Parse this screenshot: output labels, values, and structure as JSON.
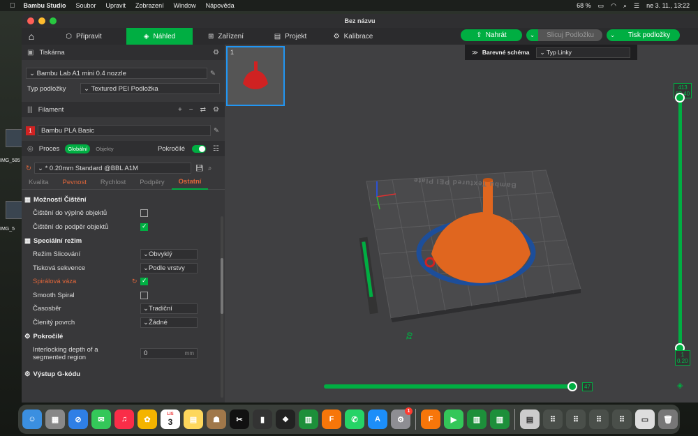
{
  "menubar": {
    "app_name": "Bambu Studio",
    "items": [
      "Soubor",
      "Upravit",
      "Zobrazení",
      "Window",
      "Nápověda"
    ],
    "battery": "68 %",
    "datetime": "ne 3. 11.,  13:22"
  },
  "desktop": {
    "label1": "IMG_585",
    "label2": "IMG_5"
  },
  "window": {
    "title": "Bez názvu"
  },
  "nav": {
    "tabs": [
      "Připravit",
      "Náhled",
      "Zařízení",
      "Projekt",
      "Kalibrace"
    ],
    "active_tab": "Náhled",
    "upload_label": "Nahrát",
    "slice_label": "Slicuj Podložku",
    "print_label": "Tisk podložky"
  },
  "printer": {
    "section_title": "Tiskárna",
    "printer_name": "Bambu Lab A1 mini 0.4 nozzle",
    "plate_type_label": "Typ podložky",
    "plate_type_value": "Textured PEI Podložka"
  },
  "filament": {
    "section_title": "Filament",
    "slot_number": "1",
    "filament_name": "Bambu PLA Basic"
  },
  "process": {
    "section_title": "Proces",
    "global_label": "Globální",
    "objects_label": "Objekty",
    "advanced_label": "Pokročilé",
    "profile": "* 0.20mm Standard @BBL A1M",
    "tabs": [
      "Kvalita",
      "Pevnost",
      "Rychlost",
      "Podpěry",
      "Ostatní"
    ],
    "active_tab": "Ostatní"
  },
  "options": {
    "cleaning_head": "Možnosti Čištění",
    "cleaning_infill": "Čištění do výplně objektů",
    "cleaning_support": "Čištění do podpěr objektů",
    "special_head": "Speciální režim",
    "slicing_mode_label": "Režim Slicování",
    "slicing_mode_value": "Obvyklý",
    "print_seq_label": "Tisková sekvence",
    "print_seq_value": "Podle vrstvy",
    "spiral_label": "Spirálová váza",
    "smooth_spiral_label": "Smooth Spiral",
    "timelapse_label": "Časosběr",
    "timelapse_value": "Tradiční",
    "fuzzy_label": "Členitý povrch",
    "fuzzy_value": "Žádné",
    "advanced_head": "Pokročilé",
    "interlock_label_1": "Interlocking depth of a",
    "interlock_label_2": "segmented region",
    "interlock_value": "0",
    "interlock_unit": "mm",
    "gcode_head": "Výstup G-kódu"
  },
  "viewport": {
    "thumb_number": "1",
    "color_scheme_label": "Barevné schéma",
    "color_scheme_value": "Typ Linky",
    "plate_text": "Bambu Textured PEI Plate",
    "plate_number": "01",
    "top_layer": "413",
    "top_height": "82.40",
    "bottom_layer": "1",
    "bottom_height": "0.20",
    "h_slider_value": "47"
  },
  "dock": {
    "calendar_month": "LIS",
    "calendar_day": "3",
    "settings_badge": "1"
  },
  "colors": {
    "accent": "#00ae42",
    "model": "#e0661f",
    "highlight": "#e0663a"
  }
}
